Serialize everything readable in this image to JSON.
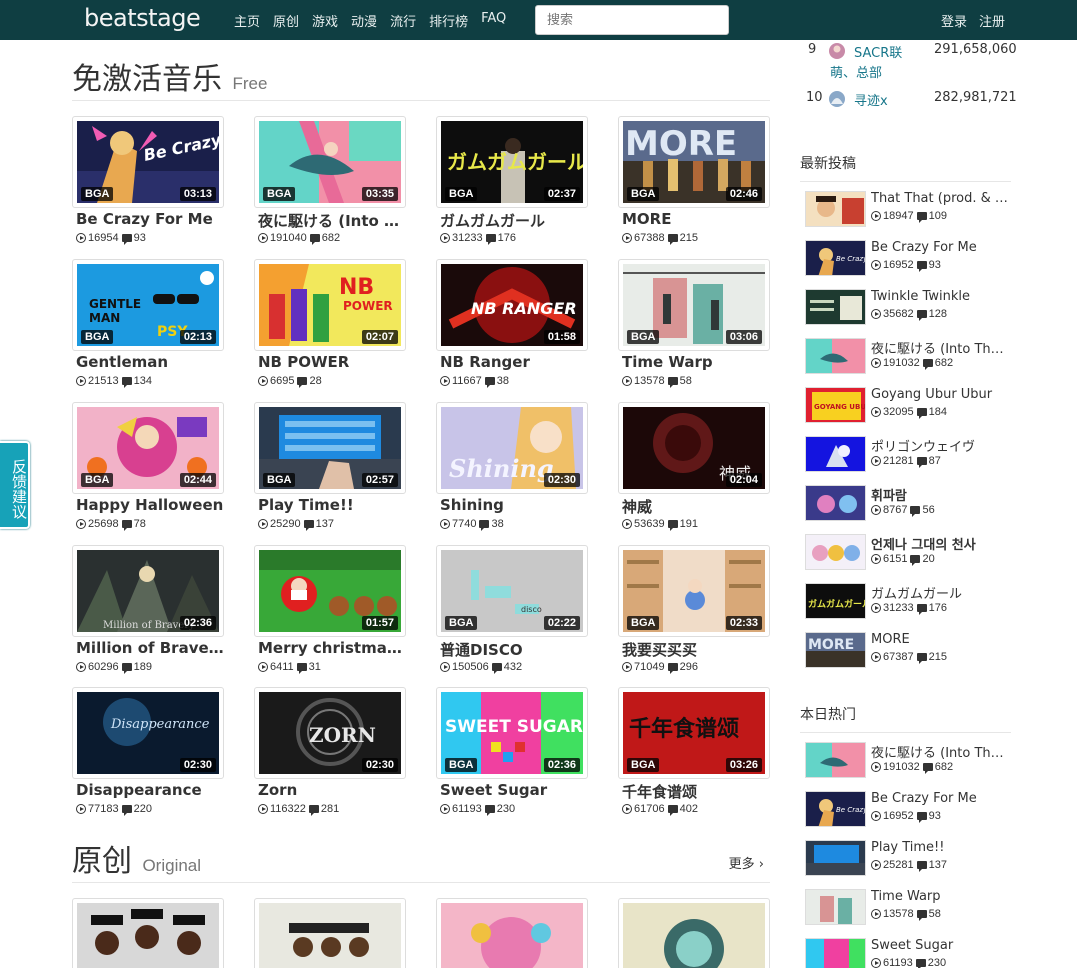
{
  "nav": {
    "logo": "beatstage",
    "links": [
      "主页",
      "原创",
      "游戏",
      "动漫",
      "流行",
      "排行榜",
      "FAQ"
    ],
    "search_placeholder": "搜索",
    "login": "登录",
    "register": "注册"
  },
  "feedback": "反馈建议",
  "sections": {
    "free": {
      "title": "免激活音乐",
      "subtitle": "Free"
    },
    "original": {
      "title": "原创",
      "subtitle": "Original",
      "more": "更多 ›"
    }
  },
  "free_items": [
    {
      "title": "Be Crazy For Me",
      "plays": "16954",
      "comments": "93",
      "bga": "BGA",
      "duration": "03:13"
    },
    {
      "title": "夜に駆ける (Into T…",
      "plays": "191040",
      "comments": "682",
      "bga": "BGA",
      "duration": "03:35"
    },
    {
      "title": "ガムガムガール",
      "plays": "31233",
      "comments": "176",
      "bga": "BGA",
      "duration": "02:37"
    },
    {
      "title": "MORE",
      "plays": "67388",
      "comments": "215",
      "bga": "BGA",
      "duration": "02:46"
    },
    {
      "title": "Gentleman",
      "plays": "21513",
      "comments": "134",
      "bga": "BGA",
      "duration": "02:13"
    },
    {
      "title": "NB POWER",
      "plays": "6695",
      "comments": "28",
      "bga": "",
      "duration": "02:07"
    },
    {
      "title": "NB Ranger",
      "plays": "11667",
      "comments": "38",
      "bga": "",
      "duration": "01:58"
    },
    {
      "title": "Time Warp",
      "plays": "13578",
      "comments": "58",
      "bga": "BGA",
      "duration": "03:06"
    },
    {
      "title": "Happy Halloween",
      "plays": "25698",
      "comments": "78",
      "bga": "BGA",
      "duration": "02:44"
    },
    {
      "title": "Play Time!!",
      "plays": "25290",
      "comments": "137",
      "bga": "BGA",
      "duration": "02:57"
    },
    {
      "title": "Shining",
      "plays": "7740",
      "comments": "38",
      "bga": "",
      "duration": "02:30"
    },
    {
      "title": "神威",
      "plays": "53639",
      "comments": "191",
      "bga": "",
      "duration": "02:04"
    },
    {
      "title": "Million of Bravery",
      "plays": "60296",
      "comments": "189",
      "bga": "",
      "duration": "02:36"
    },
    {
      "title": "Merry christmas I …",
      "plays": "6411",
      "comments": "31",
      "bga": "",
      "duration": "01:57"
    },
    {
      "title": "普通DISCO",
      "plays": "150506",
      "comments": "432",
      "bga": "BGA",
      "duration": "02:22"
    },
    {
      "title": "我要买买买",
      "plays": "71049",
      "comments": "296",
      "bga": "BGA",
      "duration": "02:33"
    },
    {
      "title": "Disappearance",
      "plays": "77183",
      "comments": "220",
      "bga": "",
      "duration": "02:30"
    },
    {
      "title": "Zorn",
      "plays": "116322",
      "comments": "281",
      "bga": "",
      "duration": "02:30"
    },
    {
      "title": "Sweet Sugar",
      "plays": "61193",
      "comments": "230",
      "bga": "BGA",
      "duration": "02:36"
    },
    {
      "title": "千年食谱颂",
      "plays": "61706",
      "comments": "402",
      "bga": "BGA",
      "duration": "03:26"
    }
  ],
  "rank": [
    {
      "num": "9",
      "name": "SACR联",
      "name2": "萌、总部",
      "score": "291,658,060"
    },
    {
      "num": "10",
      "name": "寻迹x",
      "score": "282,981,721"
    }
  ],
  "latest": {
    "title": "最新投稿",
    "items": [
      {
        "title": "That That (prod. & fe…",
        "plays": "18947",
        "comments": "109"
      },
      {
        "title": "Be Crazy For Me",
        "plays": "16952",
        "comments": "93"
      },
      {
        "title": "Twinkle Twinkle",
        "plays": "35682",
        "comments": "128"
      },
      {
        "title": "夜に駆ける (Into The…",
        "plays": "191032",
        "comments": "682"
      },
      {
        "title": "Goyang Ubur Ubur",
        "plays": "32095",
        "comments": "184"
      },
      {
        "title": "ポリゴンウェイヴ",
        "plays": "21281",
        "comments": "87"
      },
      {
        "title": "휘파람",
        "plays": "8767",
        "comments": "56"
      },
      {
        "title": "언제나 그대의 천사",
        "plays": "6151",
        "comments": "20"
      },
      {
        "title": "ガムガムガール",
        "plays": "31233",
        "comments": "176"
      },
      {
        "title": "MORE",
        "plays": "67387",
        "comments": "215"
      }
    ]
  },
  "hot": {
    "title": "本日热门",
    "items": [
      {
        "title": "夜に駆ける (Into The…",
        "plays": "191032",
        "comments": "682"
      },
      {
        "title": "Be Crazy For Me",
        "plays": "16952",
        "comments": "93"
      },
      {
        "title": "Play Time!!",
        "plays": "25281",
        "comments": "137"
      },
      {
        "title": "Time Warp",
        "plays": "13578",
        "comments": "58"
      },
      {
        "title": "Sweet Sugar",
        "plays": "61193",
        "comments": "230"
      }
    ]
  },
  "thumb_text": {
    "crazy": "Be Crazy For Me",
    "gum": "ガムガムガール",
    "more": "MORE",
    "gentle1": "GENTLE",
    "gentle2": "MAN",
    "psy": "PSY",
    "nb": "NB",
    "power": "POWER",
    "ranger": "NB RANGER",
    "shining": "Shining",
    "kamui": "神威",
    "bravery": "Million of Bravery",
    "disco": "disco",
    "dis": "Disappearance",
    "zorn": "ZORN",
    "sweet": "SWEET SUGAR",
    "sennen": "千年食谱颂",
    "goyang": "GOYANG UBUR UBUR"
  }
}
